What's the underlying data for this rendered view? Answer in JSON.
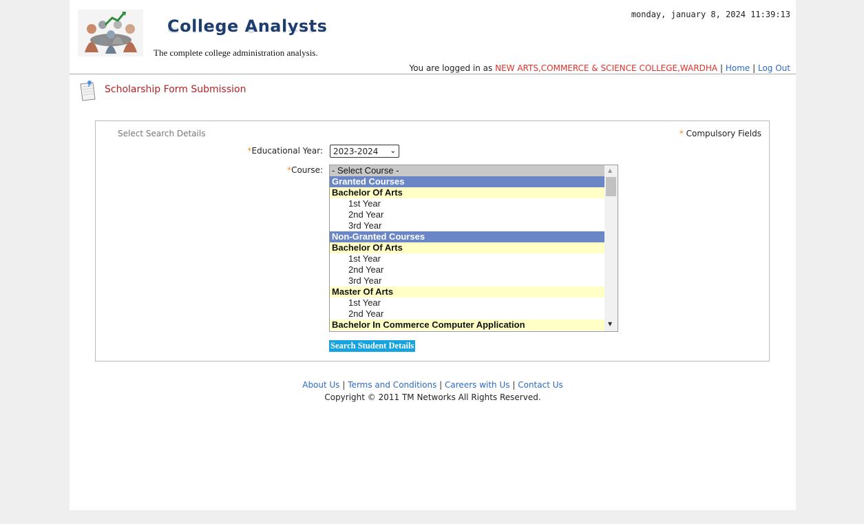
{
  "header": {
    "logo_title": "College Analysts",
    "tagline": "The complete college administration analysis.",
    "datetime": "monday, january 8, 2024 11:39:13",
    "login_prefix": "You are logged in as",
    "college_name": "NEW ARTS,COMMERCE & SCIENCE COLLEGE,WARDHA",
    "separator": "|",
    "home_link": "Home",
    "logout_link": "Log Out"
  },
  "page": {
    "title": "Scholarship Form Submission"
  },
  "form": {
    "section_label": "Select Search Details",
    "required_marker": "*",
    "compulsory_text": "Compulsory Fields",
    "year_label": "Educational Year:",
    "year_value": "2023-2024",
    "course_label": "Course:",
    "course_options": [
      {
        "text": "- Select Course -",
        "kind": "placeholder"
      },
      {
        "text": "Granted Courses",
        "kind": "group"
      },
      {
        "text": "Bachelor Of Arts",
        "kind": "program"
      },
      {
        "text": "1st Year",
        "kind": "year"
      },
      {
        "text": "2nd Year",
        "kind": "year"
      },
      {
        "text": "3rd Year",
        "kind": "year"
      },
      {
        "text": "Non-Granted Courses",
        "kind": "group"
      },
      {
        "text": "Bachelor Of Arts",
        "kind": "program"
      },
      {
        "text": "1st Year",
        "kind": "year"
      },
      {
        "text": "2nd Year",
        "kind": "year"
      },
      {
        "text": "3rd Year",
        "kind": "year"
      },
      {
        "text": "Master Of Arts",
        "kind": "program"
      },
      {
        "text": "1st Year",
        "kind": "year"
      },
      {
        "text": "2nd Year",
        "kind": "year"
      },
      {
        "text": "Bachelor In Commerce Computer Application",
        "kind": "program"
      }
    ],
    "search_button": "Search Student Details"
  },
  "footer": {
    "links": [
      "About Us",
      "Terms and Conditions",
      "Careers with Us",
      "Contact Us"
    ],
    "copyright": "Copyright © 2011 TM Networks All Rights Reserved."
  },
  "colors": {
    "accent_red": "#e0302a",
    "link_blue": "#2d6bc4",
    "button_blue": "#17a3dd",
    "group_bg": "#6b86c6",
    "program_bg": "#ffffc6"
  }
}
